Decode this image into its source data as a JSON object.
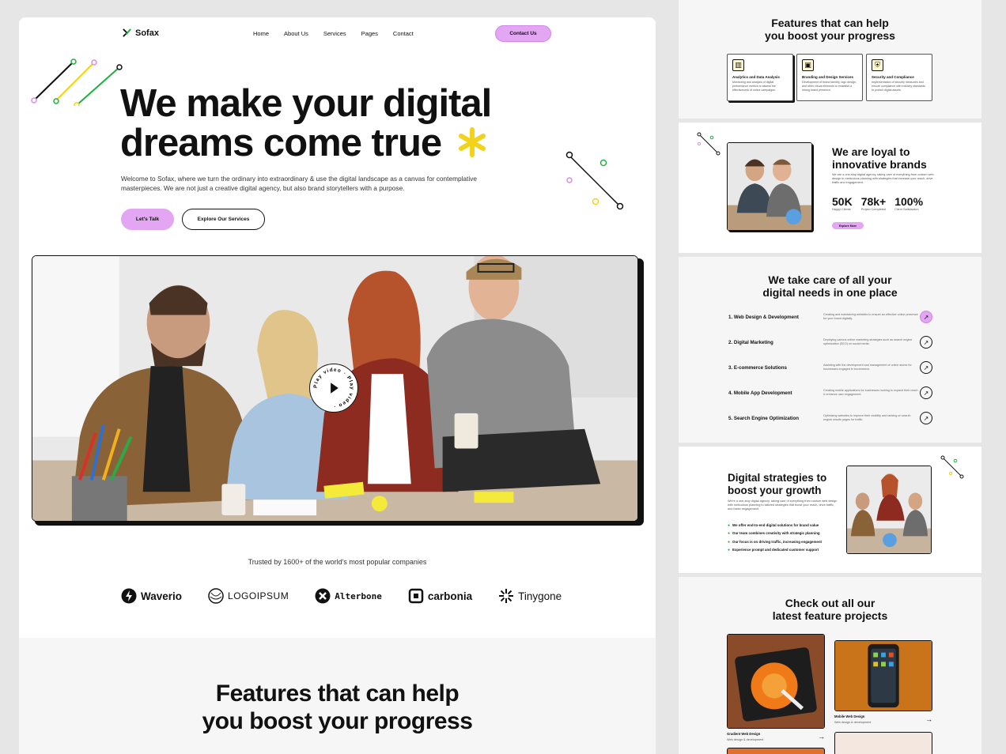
{
  "nav": {
    "brand": "Sofax",
    "links": [
      "Home",
      "About Us",
      "Services",
      "Pages",
      "Contact"
    ],
    "contact_label": "Contact Us"
  },
  "hero": {
    "title_line1": "We make your digital",
    "title_line2": "dreams come true",
    "description": "Welcome to Sofax, where we turn the ordinary into extraordinary & use the digital landscape as a canvas for contemplative masterpieces. We are not just a creative digital agency, but also brand storytellers with a purpose.",
    "primary_cta": "Let's Talk",
    "secondary_cta": "Explore Our Services",
    "play_label": "Play video · Play video ·"
  },
  "trusted": {
    "text": "Trusted by 1600+ of the world's most popular companies",
    "brands": [
      "Waverio",
      "LOGOIPSUM",
      "Alterbone",
      "carbonia",
      "Tinygone"
    ]
  },
  "features": {
    "title_line1": "Features that can help",
    "title_line2": "you boost your progress",
    "cards": [
      {
        "title": "Analytics and Data Analysis",
        "desc": "Monitoring and analysis of digital performance metrics to assess the effectiveness of online campaigns."
      },
      {
        "title": "Branding and Design Services",
        "desc": "Development of brand identity, logo design, and other visual elements to establish a strong brand presence."
      },
      {
        "title": "Security and Compliance",
        "desc": "Implementation of security measures and ensure compliance with industry standards to protect digital assets."
      }
    ]
  },
  "loyal": {
    "title_line1": "We are loyal to",
    "title_line2": "innovative brands",
    "description": "We are a one-stop digital agency, taking care of everything from custom web design to meticulous planning with strategies that increase your reach, drive traffic and engagement.",
    "stats": [
      {
        "value": "50K",
        "label": "Happy Clients"
      },
      {
        "value": "78k+",
        "label": "Project Completed"
      },
      {
        "value": "100%",
        "label": "Client Satisfaction"
      }
    ],
    "cta": "Explore More"
  },
  "services": {
    "title_line1": "We take care of all your",
    "title_line2": "digital needs in one place",
    "items": [
      {
        "name": "1. Web Design & Development",
        "desc": "Creating and maintaining websites to ensure an effective online presence for your brand digitally."
      },
      {
        "name": "2. Digital Marketing",
        "desc": "Deploying various online marketing strategies such as search engine optimization (SEO) on social media."
      },
      {
        "name": "3. E-commerce Solutions",
        "desc": "Assisting with the development and management of online stores for businesses engaged in ecommerce."
      },
      {
        "name": "4. Mobile App Development",
        "desc": "Creating mobile applications for businesses looking to expand their reach & enhance user engagement."
      },
      {
        "name": "5. Search Engine Optimization",
        "desc": "Optimizing websites to improve their visibility and ranking on search engine results pages for traffic."
      }
    ]
  },
  "strategies": {
    "title_line1": "Digital strategies to",
    "title_line2": "boost your growth",
    "description": "We're a one-stop digital agency, taking care of everything from custom web design with meticulous planning to tailored strategies that boost your reach, drive traffic, and foster engagement.",
    "checks": [
      "We offer end-to-end digital solutions for brand value",
      "Our team combines creativity with strategic planning",
      "Our focus is on driving traffic, increasing engagement",
      "Experience prompt and dedicated customer support"
    ]
  },
  "projects": {
    "title_line1": "Check out all our",
    "title_line2": "latest feature projects",
    "items": [
      {
        "title": "Gradient Web Design",
        "sub": "Web design & development"
      },
      {
        "title": "Mobile Web Design",
        "sub": "Web design & development"
      }
    ]
  },
  "colors": {
    "accent": "#e2a6f2",
    "yellow": "#f2d21a",
    "green": "#20b040",
    "dark": "#111111"
  }
}
